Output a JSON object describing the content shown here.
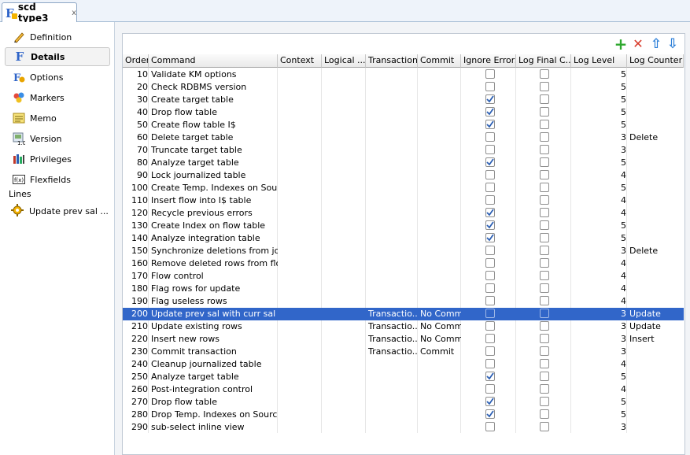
{
  "tab": {
    "title": "scd type3",
    "close": "x"
  },
  "sidebar": {
    "items": [
      {
        "label": "Definition",
        "icon": "pencil-icon"
      },
      {
        "label": "Details",
        "icon": "f-icon",
        "active": true
      },
      {
        "label": "Options",
        "icon": "options-icon"
      },
      {
        "label": "Markers",
        "icon": "markers-icon"
      },
      {
        "label": "Memo",
        "icon": "memo-icon"
      },
      {
        "label": "Version",
        "icon": "version-icon"
      },
      {
        "label": "Privileges",
        "icon": "privileges-icon"
      },
      {
        "label": "Flexfields",
        "icon": "flexfields-icon"
      }
    ],
    "lines_label": "Lines",
    "lines_item": "Update prev sal ..."
  },
  "toolbar": {
    "add": "+",
    "delete": "✕",
    "up": "⇧",
    "down": "⇩"
  },
  "columns": [
    "Order",
    "Command",
    "Context",
    "Logical ...",
    "Transaction",
    "Commit",
    "Ignore Errors",
    "Log Final C...",
    "Log Level",
    "Log Counter"
  ],
  "rows": [
    {
      "order": "10",
      "command": "Validate KM options",
      "transaction": "",
      "commit": "",
      "ignore": false,
      "logfinal": false,
      "level": "5",
      "counter": ""
    },
    {
      "order": "20",
      "command": "Check RDBMS version",
      "transaction": "",
      "commit": "",
      "ignore": false,
      "logfinal": false,
      "level": "5",
      "counter": ""
    },
    {
      "order": "30",
      "command": "Create target table",
      "transaction": "",
      "commit": "",
      "ignore": true,
      "logfinal": false,
      "level": "5",
      "counter": ""
    },
    {
      "order": "40",
      "command": "Drop flow table",
      "transaction": "",
      "commit": "",
      "ignore": true,
      "logfinal": false,
      "level": "5",
      "counter": ""
    },
    {
      "order": "50",
      "command": "Create flow table I$",
      "transaction": "",
      "commit": "",
      "ignore": true,
      "logfinal": false,
      "level": "5",
      "counter": ""
    },
    {
      "order": "60",
      "command": "Delete target table",
      "transaction": "",
      "commit": "",
      "ignore": false,
      "logfinal": false,
      "level": "3",
      "counter": "Delete"
    },
    {
      "order": "70",
      "command": "Truncate target table",
      "transaction": "",
      "commit": "",
      "ignore": false,
      "logfinal": false,
      "level": "3",
      "counter": ""
    },
    {
      "order": "80",
      "command": "Analyze target table",
      "transaction": "",
      "commit": "",
      "ignore": true,
      "logfinal": false,
      "level": "5",
      "counter": ""
    },
    {
      "order": "90",
      "command": "Lock journalized table",
      "transaction": "",
      "commit": "",
      "ignore": false,
      "logfinal": false,
      "level": "4",
      "counter": ""
    },
    {
      "order": "100",
      "command": "Create Temp. Indexes on Source",
      "transaction": "",
      "commit": "",
      "ignore": false,
      "logfinal": false,
      "level": "5",
      "counter": ""
    },
    {
      "order": "110",
      "command": "Insert flow into I$ table",
      "transaction": "",
      "commit": "",
      "ignore": false,
      "logfinal": false,
      "level": "4",
      "counter": ""
    },
    {
      "order": "120",
      "command": "Recycle previous errors",
      "transaction": "",
      "commit": "",
      "ignore": true,
      "logfinal": false,
      "level": "4",
      "counter": ""
    },
    {
      "order": "130",
      "command": "Create Index on flow table",
      "transaction": "",
      "commit": "",
      "ignore": true,
      "logfinal": false,
      "level": "5",
      "counter": ""
    },
    {
      "order": "140",
      "command": "Analyze integration table",
      "transaction": "",
      "commit": "",
      "ignore": true,
      "logfinal": false,
      "level": "5",
      "counter": ""
    },
    {
      "order": "150",
      "command": "Synchronize deletions from jou...",
      "transaction": "",
      "commit": "",
      "ignore": false,
      "logfinal": false,
      "level": "3",
      "counter": "Delete"
    },
    {
      "order": "160",
      "command": "Remove deleted rows from flo...",
      "transaction": "",
      "commit": "",
      "ignore": false,
      "logfinal": false,
      "level": "4",
      "counter": ""
    },
    {
      "order": "170",
      "command": "Flow control",
      "transaction": "",
      "commit": "",
      "ignore": false,
      "logfinal": false,
      "level": "4",
      "counter": ""
    },
    {
      "order": "180",
      "command": "Flag rows for update",
      "transaction": "",
      "commit": "",
      "ignore": false,
      "logfinal": false,
      "level": "4",
      "counter": ""
    },
    {
      "order": "190",
      "command": "Flag useless rows",
      "transaction": "",
      "commit": "",
      "ignore": false,
      "logfinal": false,
      "level": "4",
      "counter": ""
    },
    {
      "order": "200",
      "command": "Update prev sal with curr sal",
      "transaction": "Transactio...",
      "commit": "No Commit",
      "ignore": false,
      "logfinal": false,
      "level": "3",
      "counter": "Update",
      "selected": true
    },
    {
      "order": "210",
      "command": "Update existing rows",
      "transaction": "Transactio...",
      "commit": "No Commit",
      "ignore": false,
      "logfinal": false,
      "level": "3",
      "counter": "Update"
    },
    {
      "order": "220",
      "command": "Insert new rows",
      "transaction": "Transactio...",
      "commit": "No Commit",
      "ignore": false,
      "logfinal": false,
      "level": "3",
      "counter": "Insert"
    },
    {
      "order": "230",
      "command": "Commit transaction",
      "transaction": "Transactio...",
      "commit": "Commit",
      "ignore": false,
      "logfinal": false,
      "level": "3",
      "counter": ""
    },
    {
      "order": "240",
      "command": "Cleanup journalized table",
      "transaction": "",
      "commit": "",
      "ignore": false,
      "logfinal": false,
      "level": "4",
      "counter": ""
    },
    {
      "order": "250",
      "command": "Analyze target table",
      "transaction": "",
      "commit": "",
      "ignore": true,
      "logfinal": false,
      "level": "5",
      "counter": ""
    },
    {
      "order": "260",
      "command": "Post-integration control",
      "transaction": "",
      "commit": "",
      "ignore": false,
      "logfinal": false,
      "level": "4",
      "counter": ""
    },
    {
      "order": "270",
      "command": "Drop flow table",
      "transaction": "",
      "commit": "",
      "ignore": true,
      "logfinal": false,
      "level": "5",
      "counter": ""
    },
    {
      "order": "280",
      "command": "Drop Temp. Indexes on Source",
      "transaction": "",
      "commit": "",
      "ignore": true,
      "logfinal": false,
      "level": "5",
      "counter": ""
    },
    {
      "order": "290",
      "command": "sub-select inline view",
      "transaction": "",
      "commit": "",
      "ignore": false,
      "logfinal": false,
      "level": "3",
      "counter": ""
    }
  ]
}
